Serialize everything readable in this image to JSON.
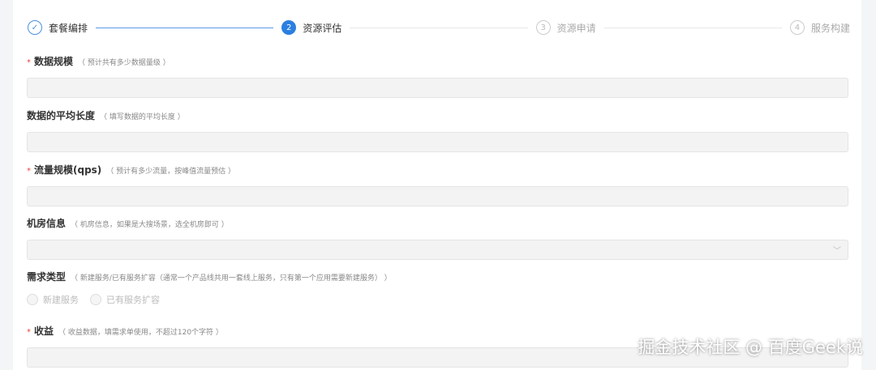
{
  "steps": [
    {
      "number": "✓",
      "label": "套餐编排",
      "state": "done"
    },
    {
      "number": "2",
      "label": "资源评估",
      "state": "active"
    },
    {
      "number": "3",
      "label": "资源申请",
      "state": "wait"
    },
    {
      "number": "4",
      "label": "服务构建",
      "state": "wait"
    }
  ],
  "fields": [
    {
      "label": "数据规模",
      "hint": "（ 预计共有多少数据量级 ）",
      "required": true
    },
    {
      "label": "数据的平均长度",
      "hint": "（ 填写数据的平均长度 ）",
      "required": false
    },
    {
      "label": "流量规模(qps)",
      "hint": "（ 预计有多少流量，按峰值流量预估 ）",
      "required": true
    },
    {
      "label": "机房信息",
      "hint": "（ 机房信息，如果是大搜场景，选全机房即可 ）",
      "required": false
    },
    {
      "label": "需求类型",
      "hint": "（ 新建服务/已有服务扩容（通常一个产品线共用一套线上服务，只有第一个应用需要新建服务）  ）",
      "required": false,
      "options": [
        "新建服务",
        "已有服务扩容"
      ]
    },
    {
      "label": "收益",
      "hint": "（ 收益数据，填需求单使用，不超过120个字符 ）",
      "required": true
    }
  ],
  "required_mark": "*",
  "select_chevron": "chevron-down-icon",
  "watermark": "掘金技术社区 @ 百度Geek说"
}
